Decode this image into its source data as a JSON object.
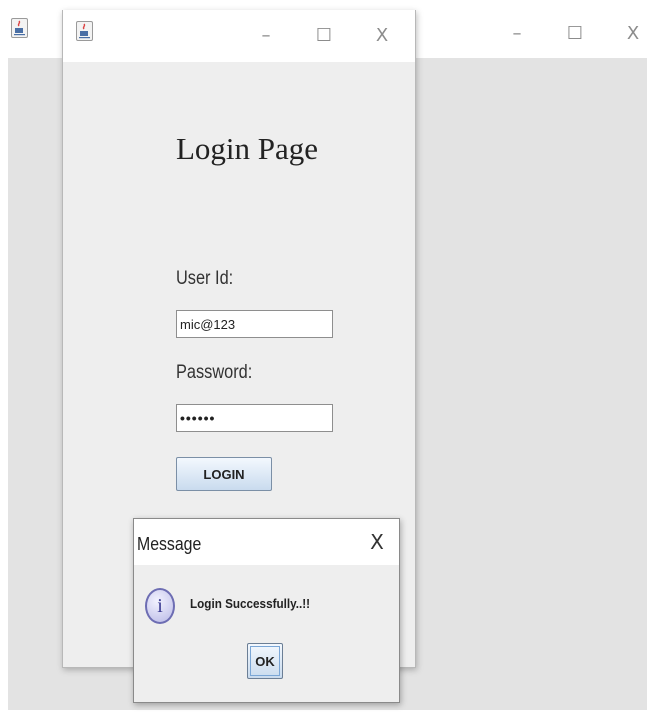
{
  "background_window": {
    "icon": "java-app-icon",
    "controls": {
      "minimize": "–",
      "maximize": "☐",
      "close": "X"
    }
  },
  "login_window": {
    "icon": "java-app-icon",
    "controls": {
      "minimize": "–",
      "maximize": "☐",
      "close": "X"
    },
    "title": "Login Page",
    "user_id_label": "User Id:",
    "user_id_value": "mic@123",
    "password_label": "Password:",
    "password_value": "••••••",
    "login_button": "LOGIN"
  },
  "message_dialog": {
    "title": "Message",
    "close": "X",
    "icon": "info-icon",
    "icon_glyph": "i",
    "message": "Login Successfully..!!",
    "ok_button": "OK"
  },
  "colors": {
    "window_bg": "#eeeeee",
    "client_bg": "#e3e3e3",
    "titlebar_bg": "#ffffff",
    "button_gradient_top": "#f3f8fe",
    "button_gradient_bottom": "#c9dbee",
    "info_icon": "#6d6db3"
  }
}
